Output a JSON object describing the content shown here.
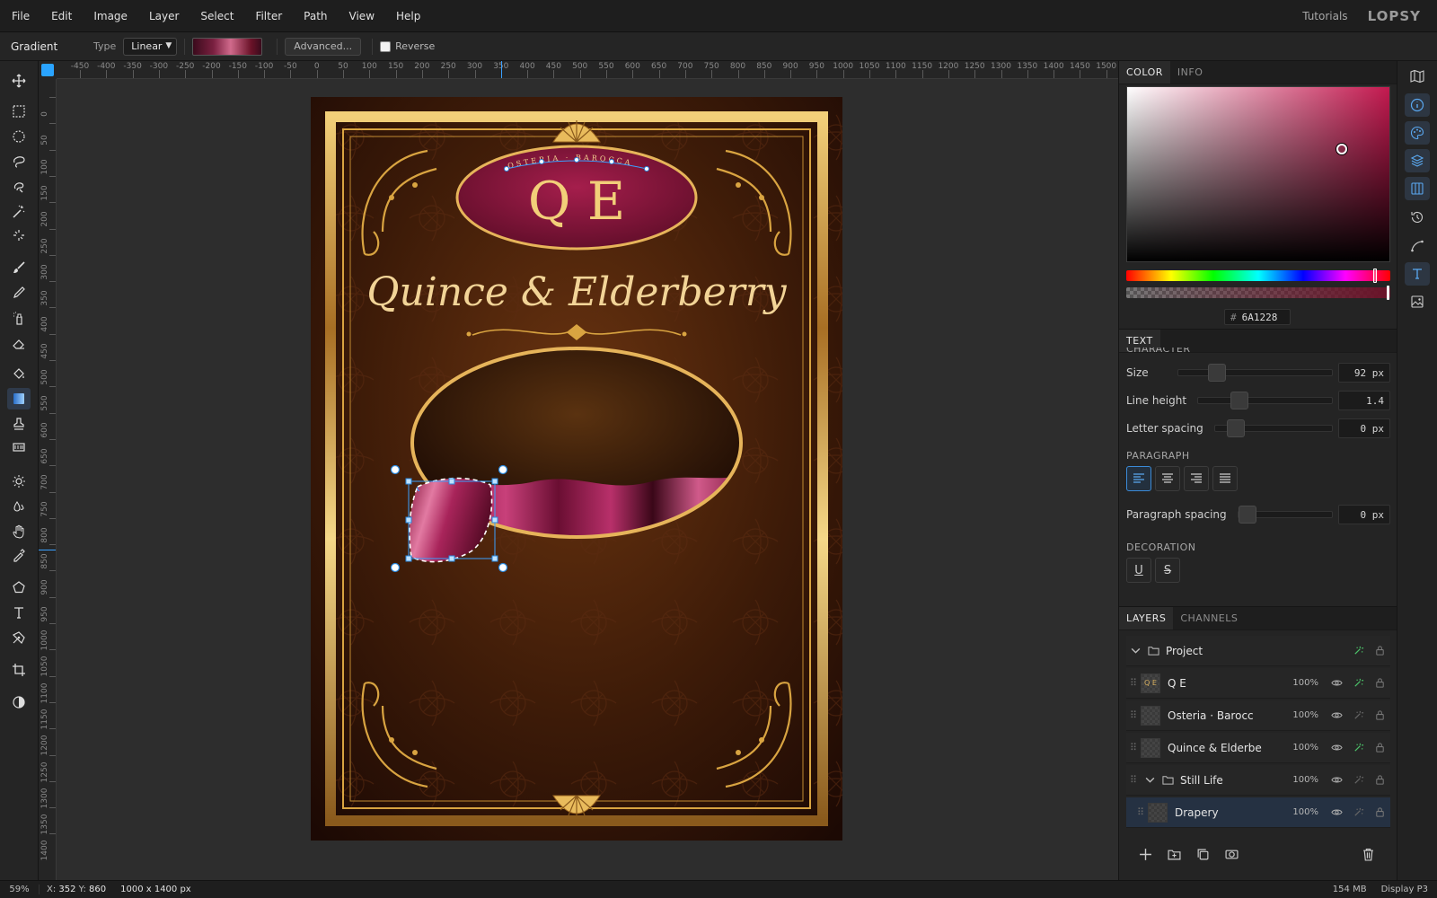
{
  "menubar": {
    "items": [
      "File",
      "Edit",
      "Image",
      "Layer",
      "Select",
      "Filter",
      "Path",
      "View",
      "Help"
    ],
    "tutorials": "Tutorials",
    "logo": "LOPSY"
  },
  "options": {
    "tool_name": "Gradient",
    "type_label": "Type",
    "type_value": "Linear",
    "advanced_label": "Advanced...",
    "reverse_label": "Reverse",
    "reverse_checked": false
  },
  "rulers": {
    "top_labels": [
      "-450",
      "-400",
      "-350",
      "-300",
      "-250",
      "-200",
      "-150",
      "-100",
      "-50",
      "0",
      "50",
      "100",
      "150",
      "200",
      "250",
      "300",
      "350",
      "400",
      "450",
      "500",
      "550",
      "600",
      "650",
      "700",
      "750",
      "800",
      "850",
      "900",
      "950",
      "1000",
      "1050",
      "1100",
      "1150",
      "1200",
      "1250",
      "1300",
      "1350",
      "1400",
      "1450",
      "1500"
    ],
    "left_labels": [
      "0",
      "50",
      "100",
      "150",
      "200",
      "250",
      "300",
      "350",
      "400",
      "450",
      "500",
      "550",
      "600",
      "650",
      "700",
      "750",
      "800",
      "850",
      "900",
      "950",
      "1000",
      "1050",
      "1100",
      "1150",
      "1200",
      "1250",
      "1300",
      "1350",
      "1400"
    ]
  },
  "artwork": {
    "monogram": "Q E",
    "arc_text": "OSTERIA · BAROCCA",
    "title": "Quince & Elderberry"
  },
  "color_panel": {
    "tabs": [
      "COLOR",
      "INFO"
    ],
    "hex_value": "6A1228",
    "hash": "#"
  },
  "text_panel": {
    "tab": "TEXT",
    "section_character": "CHARACTER",
    "size_label": "Size",
    "size_value": "92 px",
    "size_fraction": 0.22,
    "line_height_label": "Line height",
    "line_height_value": "1.4",
    "line_height_fraction": 0.28,
    "letter_spacing_label": "Letter spacing",
    "letter_spacing_value": "0 px",
    "letter_spacing_fraction": 0.12,
    "section_paragraph": "PARAGRAPH",
    "paragraph_spacing_label": "Paragraph spacing",
    "paragraph_spacing_value": "0 px",
    "paragraph_spacing_fraction": 0.0,
    "section_decoration": "DECORATION",
    "underline_label": "U",
    "strike_label": "S"
  },
  "layers_panel": {
    "tabs": [
      "LAYERS",
      "CHANNELS"
    ],
    "layers": [
      {
        "name": "Project",
        "opacity": "",
        "type": "group"
      },
      {
        "name": "Q E",
        "opacity": "100%",
        "type": "text"
      },
      {
        "name": "Osteria · Barocc",
        "opacity": "100%",
        "type": "layer"
      },
      {
        "name": "Quince & Elderbe",
        "opacity": "100%",
        "type": "layer"
      },
      {
        "name": "Still Life",
        "opacity": "100%",
        "type": "group"
      },
      {
        "name": "Drapery",
        "opacity": "100%",
        "type": "layer"
      }
    ]
  },
  "status": {
    "zoom": "59%",
    "coords_prefix_x": "X: ",
    "x": "352",
    "coords_prefix_y": " Y: ",
    "y": "860",
    "dims": "1000 x 1400 px",
    "memory": "154 MB",
    "profile": "Display P3"
  },
  "colors": {
    "accent": "#2aa4ff",
    "gold": "#d9a441",
    "wine": "#6A1228",
    "bg_dark": "#1e1e1e"
  }
}
